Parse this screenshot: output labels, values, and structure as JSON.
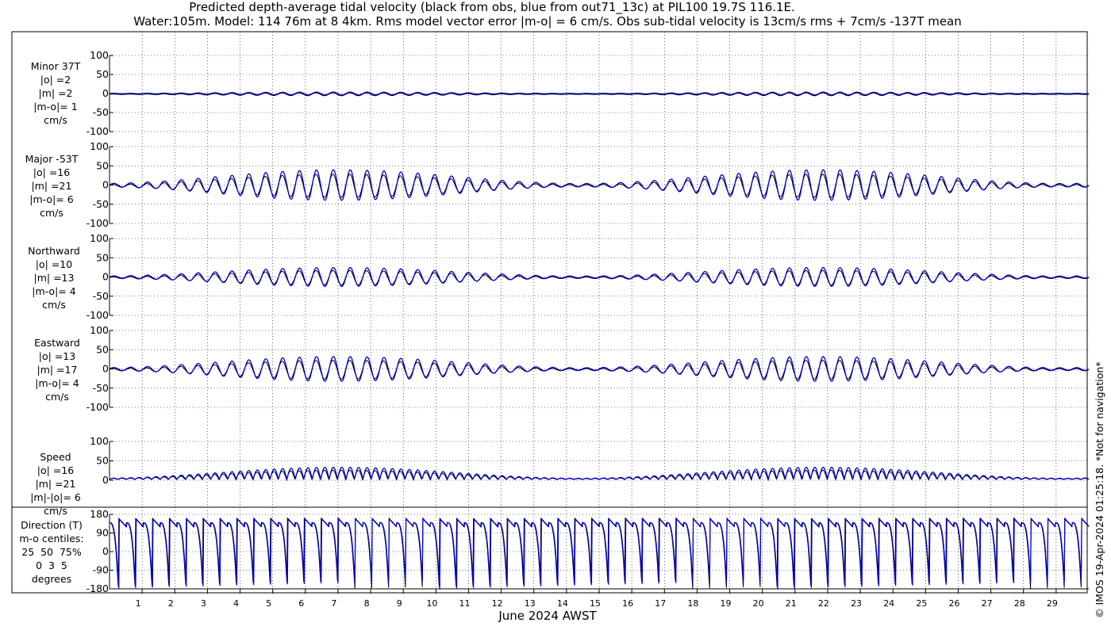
{
  "title_line1": "Predicted depth-average tidal velocity (black from obs, blue from out71_13c) at PIL100 19.7S 116.1E.",
  "title_line2": "Water:105m. Model: 114 76m at 8 4km. Rms model vector error |m-o| = 6 cm/s. Obs sub-tidal velocity is 13cm/s rms + 7cm/s -137T mean",
  "credit": "© IMOS 19-Apr-2024 01:25:18. *Not for navigation*",
  "colors": {
    "obs": "#000000",
    "model": "#0000cc",
    "grid": "#000000"
  },
  "chart_data": {
    "type": "line",
    "xlabel": "June 2024 AWST",
    "x_range_days": [
      0,
      30
    ],
    "x_ticks": [
      "1",
      "2",
      "3",
      "4",
      "5",
      "6",
      "7",
      "8",
      "9",
      "10",
      "11",
      "12",
      "13",
      "14",
      "15",
      "16",
      "17",
      "18",
      "19",
      "20",
      "21",
      "22",
      "23",
      "24",
      "25",
      "26",
      "27",
      "28",
      "29"
    ],
    "grid": true,
    "panels": [
      {
        "id": "minor",
        "label": "Minor 37T\n|o| =2\n|m| =2\n|m-o|= 1\ncm/s",
        "ylim": [
          -100,
          100
        ],
        "yticks": [
          "100",
          "50",
          "0",
          "-50",
          "-100"
        ],
        "yvals": [
          100,
          50,
          0,
          -50,
          -100
        ],
        "amplitude_obs": 2,
        "amplitude_model": 2
      },
      {
        "id": "major",
        "label": "Major -53T\n|o| =16\n|m| =21\n|m-o|= 6\ncm/s",
        "ylim": [
          -100,
          100
        ],
        "yticks": [
          "100",
          "50",
          "0",
          "-50",
          "-100"
        ],
        "yvals": [
          100,
          50,
          0,
          -50,
          -100
        ],
        "amplitude_obs": 16,
        "amplitude_model": 21
      },
      {
        "id": "north",
        "label": "Northward\n|o| =10\n|m| =13\n|m-o|= 4\ncm/s",
        "ylim": [
          -100,
          100
        ],
        "yticks": [
          "100",
          "50",
          "0",
          "-50",
          "-100"
        ],
        "yvals": [
          100,
          50,
          0,
          -50,
          -100
        ],
        "amplitude_obs": 10,
        "amplitude_model": 13
      },
      {
        "id": "east",
        "label": "Eastward\n|o| =13\n|m| =17\n|m-o|= 4\ncm/s",
        "ylim": [
          -100,
          100
        ],
        "yticks": [
          "100",
          "50",
          "0",
          "-50",
          "-100"
        ],
        "yvals": [
          100,
          50,
          0,
          -50,
          -100
        ],
        "amplitude_obs": 13,
        "amplitude_model": 17
      },
      {
        "id": "speed",
        "label": "Speed\n|o| =16\n|m| =21\n|m|-|o|= 6\ncm/s",
        "ylim": [
          0,
          100
        ],
        "yticks": [
          "100",
          "50",
          "0"
        ],
        "yvals": [
          100,
          50,
          0
        ],
        "amplitude_obs": 16,
        "amplitude_model": 21
      },
      {
        "id": "direction",
        "label": "Direction (T)\nm-o centiles:\n25  50  75%\n0  3  5\ndegrees",
        "ylim": [
          -180,
          180
        ],
        "yticks": [
          "180",
          "90",
          "0",
          "-90",
          "-180"
        ],
        "yvals": [
          180,
          90,
          0,
          -90,
          -180
        ]
      }
    ]
  }
}
